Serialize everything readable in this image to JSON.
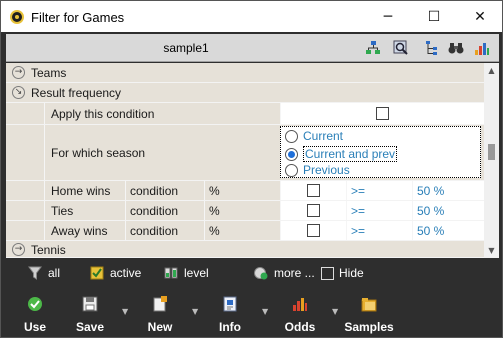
{
  "window": {
    "title": "Filter for Games",
    "minimize": "─",
    "maximize": "☐",
    "close": "✕"
  },
  "header": {
    "title": "sample1",
    "icons": [
      "tree-icon",
      "zoom-settings-icon",
      "hierarchy-icon",
      "binoculars-icon",
      "bar-chart-icon"
    ]
  },
  "grid": {
    "groups": {
      "teams": {
        "label": "Teams",
        "expanded": false
      },
      "result_frequency": {
        "label": "Result frequency",
        "expanded": true
      },
      "tennis": {
        "label": "Tennis",
        "expanded": false
      }
    },
    "apply_condition": {
      "label": "Apply this condition",
      "checked": false
    },
    "season": {
      "label": "For which season",
      "options": [
        "Current",
        "Current and prev",
        "Previous"
      ],
      "selected": "Current and prev"
    },
    "rows": [
      {
        "label": "Home wins",
        "type": "condition",
        "unit": "%",
        "checked": false,
        "op": ">=",
        "value": "50 %"
      },
      {
        "label": "Ties",
        "type": "condition",
        "unit": "%",
        "checked": false,
        "op": ">=",
        "value": "50 %"
      },
      {
        "label": "Away wins",
        "type": "condition",
        "unit": "%",
        "checked": false,
        "op": ">=",
        "value": "50 %"
      }
    ],
    "expanded_glyph": "↘",
    "collapsed_glyph": "→"
  },
  "filterbar": {
    "all": "all",
    "active": "active",
    "level": "level",
    "more": "more ...",
    "hide": "Hide"
  },
  "toolbar": {
    "use": "Use",
    "save": "Save",
    "new": "New",
    "info": "Info",
    "odds": "Odds",
    "samples": "Samples",
    "dropdown_glyph": "▼"
  },
  "colors": {
    "row_bg": "#e6e1d8",
    "value_blue": "#2a7fb8",
    "dark_bg": "#2e2e2e"
  }
}
